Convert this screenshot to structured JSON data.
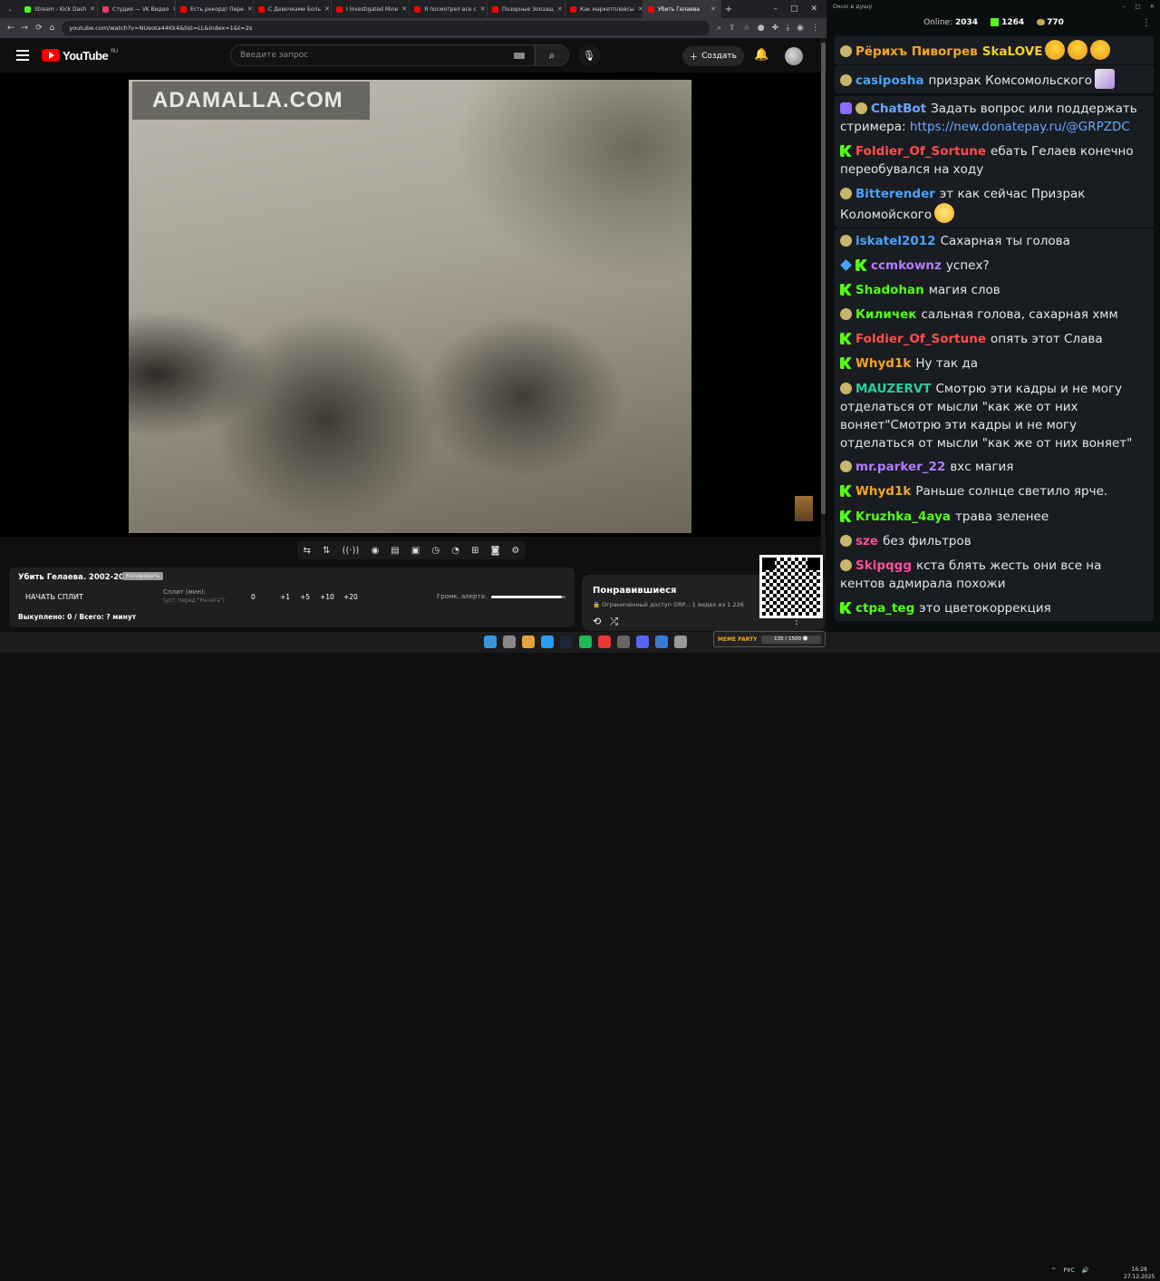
{
  "browser": {
    "tabs": [
      {
        "label": "Stream - Kick Dash",
        "color": "#53fc18"
      },
      {
        "label": "Студия — VK Видео",
        "color": "#ff3366"
      },
      {
        "label": "Есть рекорд! Пере",
        "color": "#ff0000"
      },
      {
        "label": "С Девочками Боль",
        "color": "#ff0000"
      },
      {
        "label": "I Investigated Mine",
        "color": "#ff0000"
      },
      {
        "label": "Я посмотрел все с",
        "color": "#ff0000"
      },
      {
        "label": "Позорные Зоозащ",
        "color": "#ff0000"
      },
      {
        "label": "Как маркетплейсы",
        "color": "#ff0000"
      },
      {
        "label": "Убить Гелаева",
        "color": "#ff0000",
        "active": true
      }
    ],
    "url": "youtube.com/watch?v=NUeota44Kk4&list=LL&index=1&t=2s"
  },
  "youtube": {
    "logo_text": "YouTube",
    "region": "RU",
    "search_placeholder": "Введите запрос",
    "create_label": "Создать",
    "video_watermark": "ADAMALLA.COM"
  },
  "controls": {
    "icons": [
      "repeat-icon",
      "sort-icon",
      "broadcast-icon",
      "eye-icon",
      "film-icon",
      "frame-icon",
      "time-icon",
      "speed-icon",
      "add-icon",
      "camera-icon",
      "gear-icon"
    ]
  },
  "split_panel": {
    "title": "Убить Гелаева. 2002-2004.",
    "tag": "Копировать",
    "start_button": "НАЧАТЬ СПЛИТ",
    "split_label": "Сплит (мин):",
    "split_sub": "(уст. перед \"Начать\")",
    "values": [
      "0",
      "+1",
      "+5",
      "+10",
      "+20"
    ],
    "alert_label": "Громк. алерта:",
    "alert_level": 0.95,
    "footer": "Выкуплено: 0 / Всего: ? минут"
  },
  "liked": {
    "title": "Понравившиеся",
    "subtitle": "🔒 Ограниченный доступ GRP...   1 видео из 1 226"
  },
  "taskbar": {
    "meme_label": "MEME PARTY",
    "meme_progress": "135 / 1500 ☻",
    "lang": "РУС",
    "time": "16:28",
    "date": "27.12.2025"
  },
  "chat": {
    "window_title": "Окно в душу",
    "online_label": "Online:",
    "online_count": "2034",
    "followers": "1264",
    "subs": "770",
    "messages": [
      {
        "user": "Рёрихъ Пивогрев",
        "color": "#f5a623",
        "badges": [
          "c"
        ],
        "text": "SkaLOVE",
        "text_color": "#f5d020",
        "emotes": [
          "p",
          "p",
          "p"
        ]
      },
      {
        "user": "casiposha",
        "color": "#4aa3ff",
        "badges": [
          "c"
        ],
        "text": "призрак Комсомольского",
        "emotes": [
          "g"
        ]
      },
      {
        "user": "ChatBot",
        "color": "#6aa8ff",
        "badges": [
          "b",
          "c"
        ],
        "text": "Задать вопрос или поддержать стримера: ",
        "link": "https://new.donatepay.ru/@GRPZDC"
      },
      {
        "user": "Foldier_Of_Sortune",
        "color": "#ff4d4d",
        "badges": [
          "k"
        ],
        "text": "ебать Гелаев конечно переобувался на ходу"
      },
      {
        "user": "Bitterender",
        "color": "#4aa3ff",
        "badges": [
          "c"
        ],
        "text": "эт как сейчас Призрак Коломойского",
        "emotes": [
          "l"
        ]
      },
      {
        "user": "iskatel2012",
        "color": "#4aa3ff",
        "badges": [
          "c"
        ],
        "text": "Сахарная ты голова"
      },
      {
        "user": "ccmkownz",
        "color": "#b27bff",
        "badges": [
          "s",
          "k"
        ],
        "text": "успех?"
      },
      {
        "user": "Shadohan",
        "color": "#53fc18",
        "badges": [
          "k"
        ],
        "text": "магия слов"
      },
      {
        "user": "Киличек",
        "color": "#53fc18",
        "badges": [
          "c"
        ],
        "text": "сальная голова, сахарная хмм"
      },
      {
        "user": "Foldier_Of_Sortune",
        "color": "#ff4d4d",
        "badges": [
          "k"
        ],
        "text": "опять этот Слава"
      },
      {
        "user": "Whyd1k",
        "color": "#f5a623",
        "badges": [
          "k"
        ],
        "text": "Ну так да"
      },
      {
        "user": "MAUZERVT",
        "color": "#2ecc9a",
        "badges": [
          "c"
        ],
        "text": "Смотрю эти кадры и не могу отделаться от мысли \"как же от них воняет\"Смотрю эти кадры и не могу отделаться от мысли \"как же от них воняет\""
      },
      {
        "user": "mr.parker_22",
        "color": "#b27bff",
        "badges": [
          "c"
        ],
        "text": "вхс магия"
      },
      {
        "user": "Whyd1k",
        "color": "#f5a623",
        "badges": [
          "k"
        ],
        "text": "Раньше солнце светило ярче."
      },
      {
        "user": "Kruzhka_4aya",
        "color": "#53fc18",
        "badges": [
          "k"
        ],
        "text": "трава зеленее"
      },
      {
        "user": "sze",
        "color": "#ff4d9a",
        "badges": [
          "c"
        ],
        "text": "без фильтров"
      },
      {
        "user": "Skipqgg",
        "color": "#ff4d9a",
        "badges": [
          "c"
        ],
        "text": "кста блять жесть они все на кентов адмирала похожи"
      },
      {
        "user": "ctpa_teg",
        "color": "#53fc18",
        "badges": [
          "k"
        ],
        "text": "это цветокоррекция"
      }
    ]
  }
}
